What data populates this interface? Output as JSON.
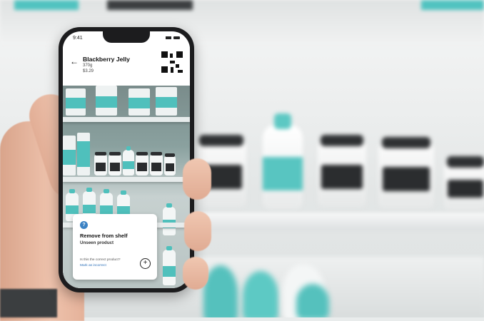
{
  "status_bar": {
    "time": "9:41"
  },
  "header": {
    "back_icon": "arrow-left-icon",
    "title": "Blackberry Jelly",
    "size": "370g",
    "price": "$3.29"
  },
  "card": {
    "info_icon": "info-icon",
    "title": "Remove from shelf",
    "subtitle": "Unseen product",
    "question": "Is this the correct product?",
    "link": "Mark as incorrect",
    "add_icon": "plus-circle-icon"
  },
  "colors": {
    "accent": "#4fc0bc",
    "link": "#2a6fb8",
    "info": "#3b82c4"
  }
}
